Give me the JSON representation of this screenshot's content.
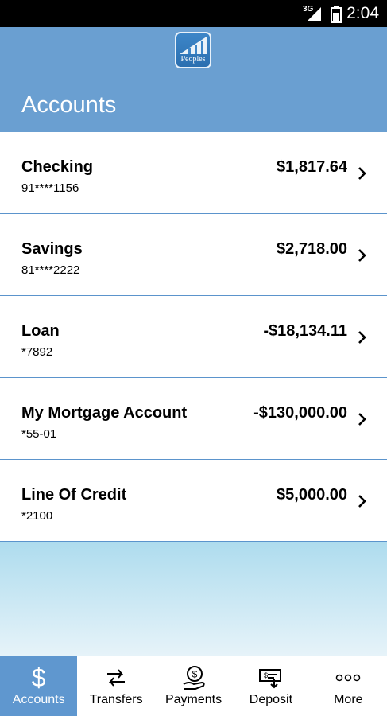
{
  "status_bar": {
    "network": "3G",
    "time": "2:04"
  },
  "header": {
    "logo_text": "Peoples",
    "title": "Accounts"
  },
  "accounts": [
    {
      "name": "Checking",
      "number": "91****1156",
      "balance": "$1,817.64"
    },
    {
      "name": "Savings",
      "number": "81****2222",
      "balance": "$2,718.00"
    },
    {
      "name": "Loan",
      "number": "*7892",
      "balance": "-$18,134.11"
    },
    {
      "name": "My Mortgage Account",
      "number": "*55-01",
      "balance": "-$130,000.00"
    },
    {
      "name": "Line Of Credit",
      "number": "*2100",
      "balance": "$5,000.00"
    }
  ],
  "tabs": [
    {
      "label": "Accounts",
      "icon": "dollar-icon",
      "active": true
    },
    {
      "label": "Transfers",
      "icon": "transfer-arrows-icon",
      "active": false
    },
    {
      "label": "Payments",
      "icon": "payment-hand-icon",
      "active": false
    },
    {
      "label": "Deposit",
      "icon": "check-deposit-icon",
      "active": false
    },
    {
      "label": "More",
      "icon": "more-dots-icon",
      "active": false
    }
  ],
  "colors": {
    "header": "#6a9fd1",
    "active_tab": "#5f97cf",
    "divider": "#5b94cc"
  }
}
